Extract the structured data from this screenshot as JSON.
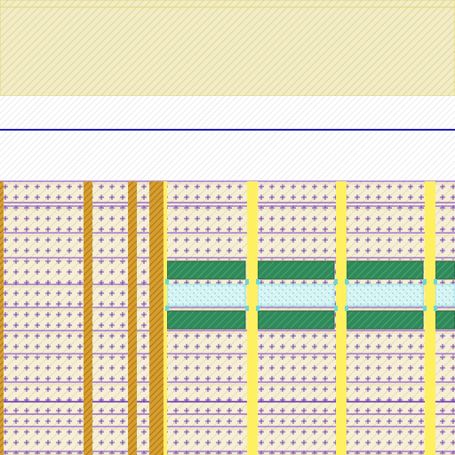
{
  "view": {
    "title": "",
    "background": "#ffffff"
  },
  "layers": {
    "metal_hatch": {
      "fill": "#f2ecc8",
      "hatch": "#d8cf7e",
      "border": "#e2d67a"
    },
    "via_grid": {
      "fill": "#f5efd6",
      "cross": "#6a2cb8",
      "hatch": "#d9c99a"
    },
    "gate_column": {
      "fill": "#d59e2e",
      "hatch": "#a26a10"
    },
    "yellow_column": {
      "fill": "#fff062"
    },
    "green_active": {
      "fill": "#2f8a5a",
      "hatch": "#5fb08a",
      "border": "#2a5c3c"
    },
    "cyan_implant": {
      "fill": "#dff5f5",
      "dot": "#6cd6d6"
    },
    "routing_wire": {
      "stroke": "#1c1cc0"
    },
    "purple_line": {
      "stroke": "#7a3ad0"
    },
    "light_hatch": {
      "hatch": "#d9d9d9"
    }
  }
}
